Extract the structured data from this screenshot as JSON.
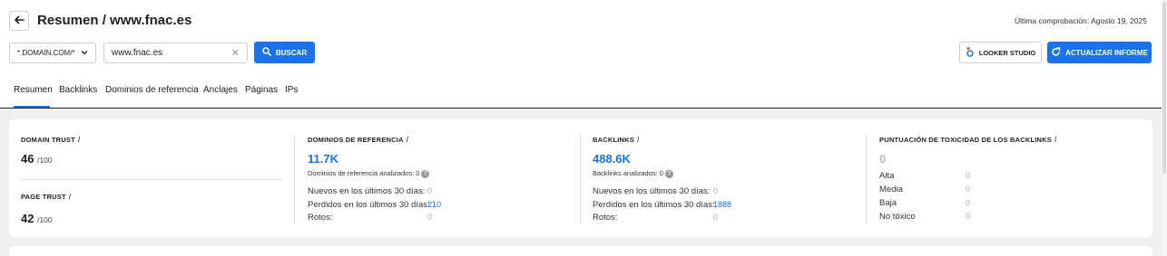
{
  "header": {
    "title": "Resumen / www.fnac.es",
    "last_check": "Última comprobación: Agosto 19, 2025"
  },
  "search": {
    "domain_mode": "*.DOMAIN.COM/*",
    "value": "www.fnac.es",
    "search_label": "BUSCAR"
  },
  "actions": {
    "looker_label": "LOOKER STUDIO",
    "update_label": "ACTUALIZAR INFORME"
  },
  "tabs": [
    {
      "label": "Resumen"
    },
    {
      "label": "Backlinks"
    },
    {
      "label": "Dominios de referencia"
    },
    {
      "label": "Anclajes"
    },
    {
      "label": "Páginas"
    },
    {
      "label": "IPs"
    }
  ],
  "metrics": {
    "domain_trust": {
      "label": "DOMAIN TRUST",
      "info": "i",
      "value": "46",
      "max": "/100"
    },
    "page_trust": {
      "label": "PAGE TRUST",
      "info": "i",
      "value": "42",
      "max": "/100"
    },
    "ref_domains": {
      "label": "DOMINIOS DE REFERENCIA",
      "info": "i",
      "value": "11.7K",
      "analyzed": "Dominios de referencia analizados: 0",
      "new_label": "Nuevos en los últimos 30 días:",
      "new_value": "0",
      "lost_label": "Perdidos en los últimos 30 días:",
      "lost_value": "210",
      "broken_label": "Rotos:",
      "broken_value": "0"
    },
    "backlinks": {
      "label": "BACKLINKS",
      "info": "i",
      "value": "488.6K",
      "analyzed": "Backlinks analizados: 0",
      "new_label": "Nuevos en los últimos 30 días:",
      "new_value": "0",
      "lost_label": "Perdidos en los últimos 30 días:",
      "lost_value": "1888",
      "broken_label": "Rotos:",
      "broken_value": "0"
    },
    "toxicity": {
      "label": "PUNTUACIÓN DE TOXICIDAD DE LOS BACKLINKS",
      "info": "i",
      "value": "0",
      "rows": [
        {
          "label": "Alta",
          "value": "0"
        },
        {
          "label": "Media",
          "value": "0"
        },
        {
          "label": "Baja",
          "value": "0"
        },
        {
          "label": "No tóxico",
          "value": "0"
        }
      ]
    }
  },
  "colors": {
    "accent": "#1a73e8",
    "background": "#efefef"
  }
}
